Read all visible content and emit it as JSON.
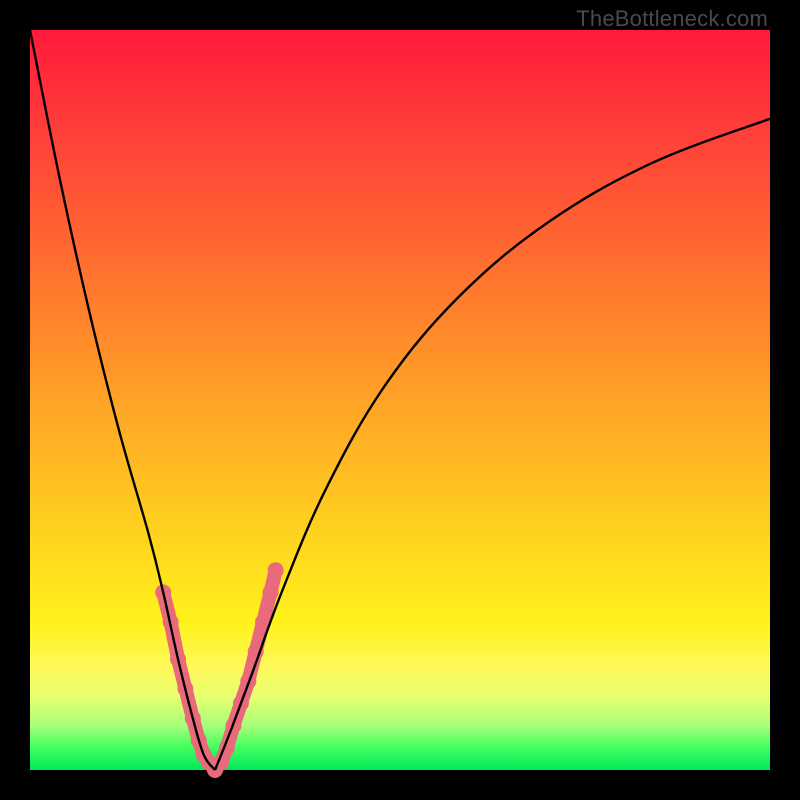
{
  "watermark": "TheBottleneck.com",
  "colors": {
    "accent": "#e96a7a",
    "curve": "#000000",
    "frame": "#000000"
  },
  "chart_data": {
    "type": "line",
    "title": "",
    "xlabel": "",
    "ylabel": "",
    "xlim": [
      0,
      100
    ],
    "ylim": [
      0,
      100
    ],
    "grid": false,
    "legend": false,
    "note": "Bottleneck-style V-curve. Axes are unlabeled percentage-like scales; values estimated from pixel positions.",
    "series": [
      {
        "name": "left-branch",
        "x": [
          0,
          4,
          8,
          12,
          16,
          18,
          20,
          22,
          23.5,
          25
        ],
        "y": [
          100,
          80,
          62,
          46,
          32,
          24,
          15,
          7,
          2,
          0
        ]
      },
      {
        "name": "right-branch",
        "x": [
          25,
          27,
          30,
          34,
          40,
          48,
          58,
          70,
          84,
          100
        ],
        "y": [
          0,
          5,
          13,
          24,
          38,
          52,
          64,
          74,
          82,
          88
        ]
      }
    ],
    "highlight_points": {
      "name": "accent-markers",
      "comment": "Salmon dots/segments near trough indicating near-zero-bottleneck zone",
      "x": [
        18,
        19,
        20,
        21,
        22,
        22.8,
        23.5,
        24.2,
        25,
        25.8,
        26.6,
        27.5,
        28.5,
        29.5,
        30.5,
        31.5,
        32.5,
        33.2
      ],
      "y": [
        24,
        20,
        15,
        11,
        7,
        4,
        2,
        1,
        0,
        1,
        3,
        6,
        9,
        12,
        16,
        20,
        24,
        27
      ]
    }
  }
}
